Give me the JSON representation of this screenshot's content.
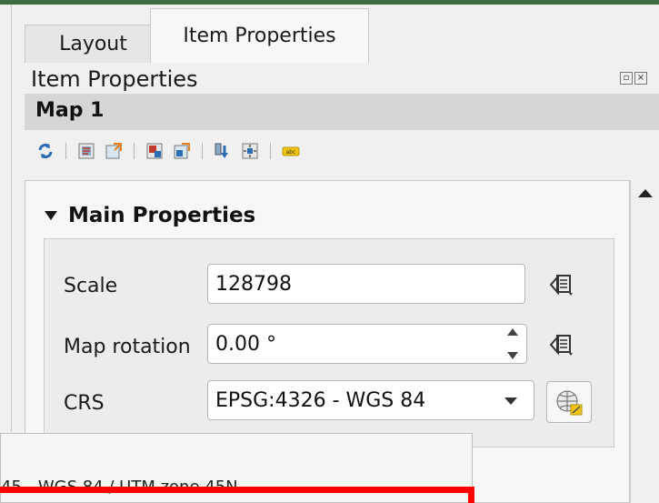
{
  "tabs": [
    {
      "label": "Layout",
      "active": false
    },
    {
      "label": "Item Properties",
      "active": true
    }
  ],
  "dock": {
    "title": "Item Properties",
    "float_icon": "float-icon",
    "close_icon": "close-icon"
  },
  "item": {
    "name": "Map 1"
  },
  "toolbar": {
    "icons": [
      "refresh-icon",
      "set-map-extent-icon",
      "view-extent-in-map-canvas-icon",
      "set-scale-icon",
      "view-scale-icon",
      "move-content-icon",
      "center-content-icon",
      "label-icon"
    ]
  },
  "section": {
    "title": "Main Properties"
  },
  "scale": {
    "label": "Scale",
    "value": "128798"
  },
  "rotation": {
    "label": "Map rotation",
    "value": "0.00 °"
  },
  "crs": {
    "label": "CRS",
    "value": "EPSG:4326 - WGS 84"
  },
  "popup": {
    "item_text": "45 - WGS 84 / UTM zone 45N"
  },
  "colors": {
    "topbar": "#3f6b45",
    "highlight": "#ff0000",
    "header": "#d6d6d6"
  }
}
